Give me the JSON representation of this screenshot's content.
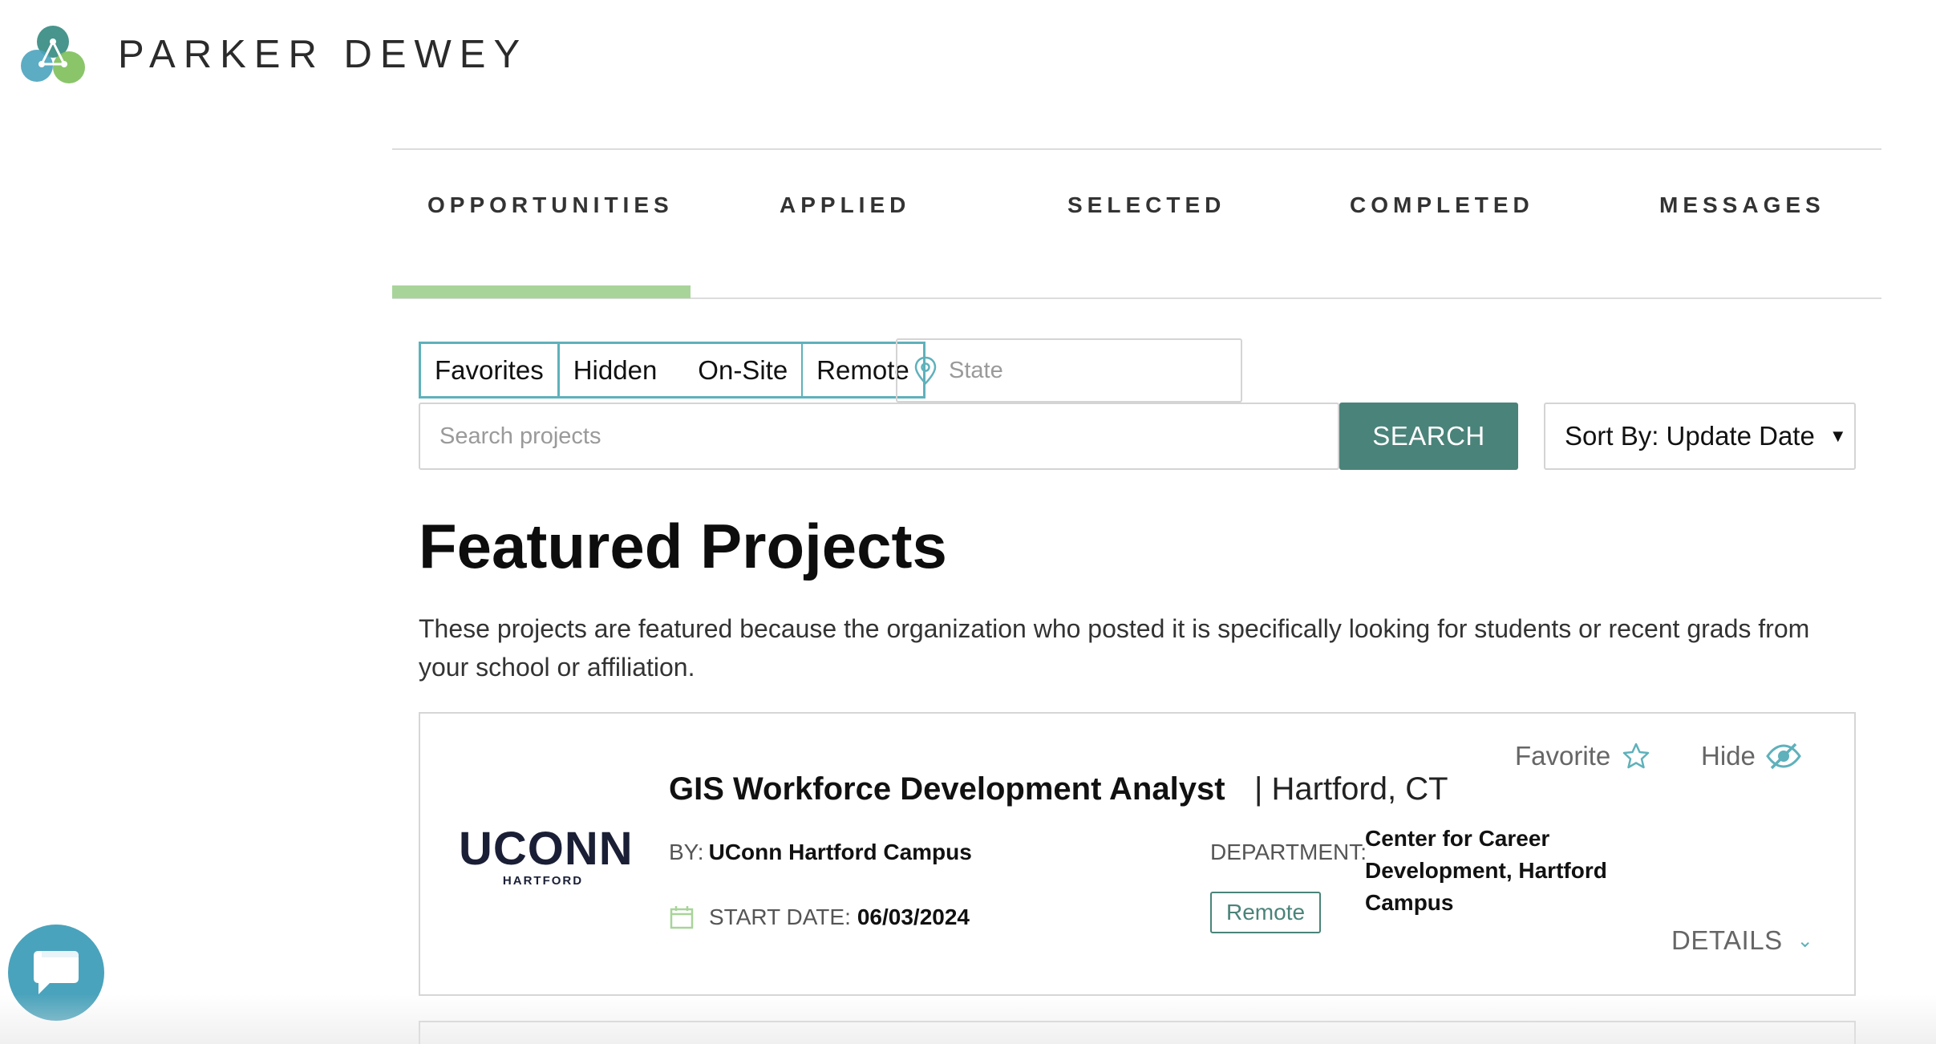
{
  "brand": {
    "name": "PARKER DEWEY"
  },
  "tabs": [
    {
      "label": "OPPORTUNITIES",
      "active": true
    },
    {
      "label": "APPLIED",
      "active": false
    },
    {
      "label": "SELECTED",
      "active": false
    },
    {
      "label": "COMPLETED",
      "active": false
    },
    {
      "label": "MESSAGES",
      "active": false
    }
  ],
  "filters": {
    "buttons": [
      "Favorites",
      "Hidden",
      "On-Site",
      "Remote"
    ],
    "state_placeholder": "State",
    "search_placeholder": "Search projects",
    "search_button": "SEARCH",
    "sort_label": "Sort By: Update Date"
  },
  "featured": {
    "title": "Featured Projects",
    "description": "These projects are featured because the organization who posted it is specifically looking for students or recent grads from your school or affiliation."
  },
  "project": {
    "org_logo_main": "UCONN",
    "org_logo_sub": "HARTFORD",
    "favorite_label": "Favorite",
    "hide_label": "Hide",
    "title": "GIS Workforce Development Analyst",
    "location": "| Hartford, CT",
    "by_label": "BY:",
    "by_value": "UConn Hartford Campus",
    "start_label": "START DATE:",
    "start_value": "06/03/2024",
    "department_label": "DEPARTMENT:",
    "department_value": "Center for Career Development, Hartford Campus",
    "tag": "Remote",
    "details_label": "DETAILS"
  },
  "colors": {
    "accent_teal": "#5fb1bb",
    "search_green": "#4a8379",
    "tab_indicator": "#a8d49a",
    "chat_blue": "#4aa3bc"
  }
}
